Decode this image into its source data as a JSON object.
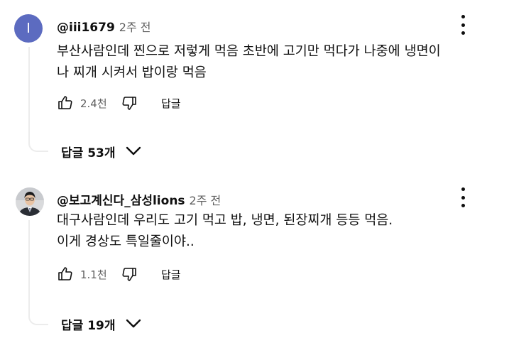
{
  "comments": [
    {
      "avatar_letter": "I",
      "avatar_color": "#5c6bc0",
      "author": "@iii1679",
      "time": "2주 전",
      "text_lines": [
        "부산사람인데 찐으로 저렇게 먹음 초반에 고기만 먹다가 나중에 냉면이",
        "나 찌개 시켜서 밥이랑 먹음"
      ],
      "likes": "2.4천",
      "reply_label": "답글",
      "replies_label": "답글 53개"
    },
    {
      "avatar_letter": "",
      "author": "@보고계신다_삼성lions",
      "time": "2주 전",
      "text_lines": [
        "대구사람인데 우리도 고기 먹고 밥, 냉면, 된장찌개 등등 먹음.",
        "이게 경상도 특일줄이야.."
      ],
      "likes": "1.1천",
      "reply_label": "답글",
      "replies_label": "답글 19개"
    }
  ],
  "icons": {
    "like": "thumb-up-icon",
    "dislike": "thumb-down-icon",
    "more": "more-vertical-icon",
    "expand": "chevron-down-icon"
  }
}
